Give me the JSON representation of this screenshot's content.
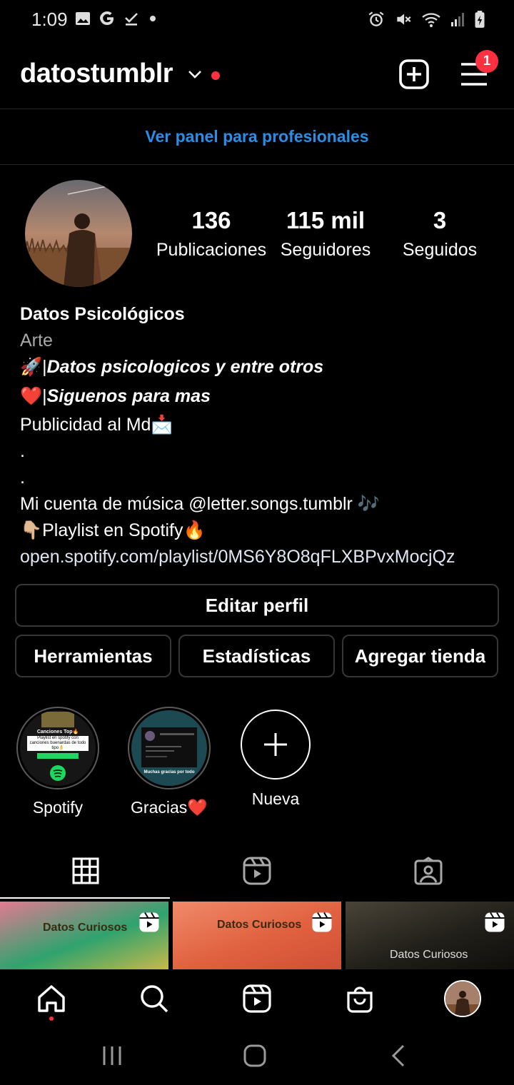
{
  "status_bar": {
    "time": "1:09",
    "left_icons": [
      "image-icon",
      "google-g-icon",
      "download-done-icon",
      "dot-icon"
    ],
    "right_icons": [
      "alarm-icon",
      "mute-icon",
      "wifi-icon",
      "signal-icon",
      "battery-icon"
    ]
  },
  "header": {
    "username": "datostumblr",
    "menu_badge": "1"
  },
  "pro_link": "Ver panel para profesionales",
  "stats": [
    {
      "value": "136",
      "label": "Publicaciones"
    },
    {
      "value": "115 mil",
      "label": "Seguidores"
    },
    {
      "value": "3",
      "label": "Seguidos"
    }
  ],
  "bio": {
    "name": "Datos Psicológicos",
    "category": "Arte",
    "line1_emoji": "🚀|",
    "line1": " Datos psicologicos y entre otros",
    "line2_emoji": "❤️|",
    "line2": " Siguenos para mas",
    "line3": "Publicidad al Md📩",
    "dot1": ".",
    "dot2": ".",
    "music": "Mi cuenta de música @letter.songs.tumblr 🎶",
    "playlist": "👇🏼Playlist en Spotify🔥",
    "link": "open.spotify.com/playlist/0MS6Y8O8qFLXBPvxMocjQz"
  },
  "buttons": {
    "edit": "Editar perfil",
    "tools": "Herramientas",
    "insights": "Estadísticas",
    "shop": "Agregar tienda"
  },
  "highlights": [
    {
      "label": "Spotify",
      "cover_title": "Canciones Top🔥",
      "cover_text": "Playlist en spotify con canciones buenardas de todo tipo👌"
    },
    {
      "label": "Gracias❤️",
      "cover_text": "Muchas gracias por todo"
    },
    {
      "label": "Nueva"
    }
  ],
  "tabs": [
    "grid-icon",
    "reels-icon",
    "tagged-icon"
  ],
  "grid": [
    {
      "title": "Datos Curiosos",
      "colors": [
        "#e27a92",
        "#2fa36e",
        "#c9b84a"
      ]
    },
    {
      "title": "Datos Curiosos",
      "colors": [
        "#f08a6a",
        "#e0613f",
        "#d04f37"
      ]
    },
    {
      "title": "Datos Curiosos",
      "colors": [
        "#4a4438",
        "#22201a",
        "#0f0e0b"
      ]
    }
  ],
  "bottom_nav": [
    "home-icon",
    "search-icon",
    "reels-icon",
    "shop-icon",
    "profile-avatar"
  ],
  "colors": {
    "accent": "#2a8ee8",
    "notification": "#ff3040",
    "border": "#363636"
  }
}
